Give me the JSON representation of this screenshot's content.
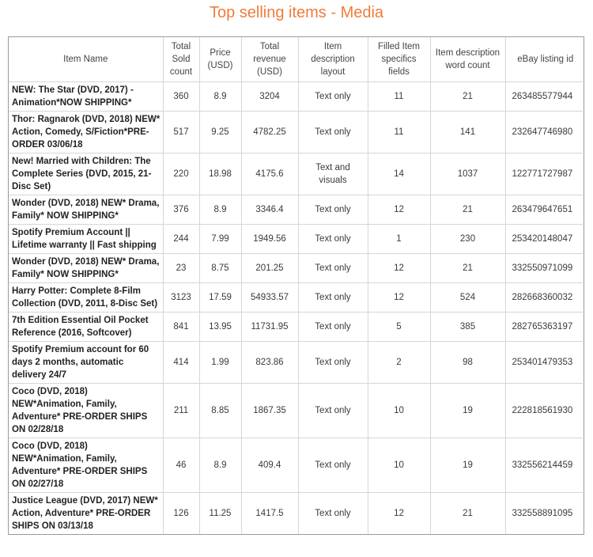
{
  "title": "Top selling items - Media",
  "columns": [
    "Item Name",
    "Total Sold count",
    "Price (USD)",
    "Total revenue (USD)",
    "Item description layout",
    "Filled Item specifics fields",
    "Item description word count",
    "eBay listing id"
  ],
  "rows": [
    {
      "name": "NEW: The Star (DVD, 2017) - Animation*NOW SHIPPING*",
      "sold": "360",
      "price": "8.9",
      "revenue": "3204",
      "layout": "Text only",
      "specifics": "11",
      "words": "21",
      "listing": "263485577944"
    },
    {
      "name": "Thor: Ragnarok (DVD, 2018) NEW* Action, Comedy, S/Fiction*PRE-ORDER 03/06/18",
      "sold": "517",
      "price": "9.25",
      "revenue": "4782.25",
      "layout": "Text only",
      "specifics": "11",
      "words": "141",
      "listing": "232647746980"
    },
    {
      "name": "New! Married with Children: The Complete Series (DVD, 2015, 21-Disc Set)",
      "sold": "220",
      "price": "18.98",
      "revenue": "4175.6",
      "layout": "Text and visuals",
      "specifics": "14",
      "words": "1037",
      "listing": "122771727987"
    },
    {
      "name": "Wonder (DVD, 2018) NEW* Drama, Family* NOW SHIPPING*",
      "sold": "376",
      "price": "8.9",
      "revenue": "3346.4",
      "layout": "Text only",
      "specifics": "12",
      "words": "21",
      "listing": "263479647651"
    },
    {
      "name": "Spotify Premium Account || Lifetime warranty || Fast shipping",
      "sold": "244",
      "price": "7.99",
      "revenue": "1949.56",
      "layout": "Text only",
      "specifics": "1",
      "words": "230",
      "listing": "253420148047"
    },
    {
      "name": "Wonder (DVD, 2018) NEW* Drama, Family* NOW SHIPPING*",
      "sold": "23",
      "price": "8.75",
      "revenue": "201.25",
      "layout": "Text only",
      "specifics": "12",
      "words": "21",
      "listing": "332550971099"
    },
    {
      "name": "Harry Potter: Complete 8-Film Collection (DVD, 2011, 8-Disc Set)",
      "sold": "3123",
      "price": "17.59",
      "revenue": "54933.57",
      "layout": "Text only",
      "specifics": "12",
      "words": "524",
      "listing": "282668360032"
    },
    {
      "name": "7th Edition Essential Oil Pocket Reference (2016, Softcover)",
      "sold": "841",
      "price": "13.95",
      "revenue": "11731.95",
      "layout": "Text only",
      "specifics": "5",
      "words": "385",
      "listing": "282765363197"
    },
    {
      "name": "Spotify Premium account for 60 days 2 months, automatic delivery 24/7",
      "sold": "414",
      "price": "1.99",
      "revenue": "823.86",
      "layout": "Text only",
      "specifics": "2",
      "words": "98",
      "listing": "253401479353"
    },
    {
      "name": "Coco (DVD, 2018) NEW*Animation, Family, Adventure* PRE-ORDER SHIPS ON 02/28/18",
      "sold": "211",
      "price": "8.85",
      "revenue": "1867.35",
      "layout": "Text only",
      "specifics": "10",
      "words": "19",
      "listing": "222818561930"
    },
    {
      "name": "Coco (DVD, 2018) NEW*Animation, Family, Adventure* PRE-ORDER SHIPS ON 02/27/18",
      "sold": "46",
      "price": "8.9",
      "revenue": "409.4",
      "layout": "Text only",
      "specifics": "10",
      "words": "19",
      "listing": "332556214459"
    },
    {
      "name": "Justice League (DVD, 2017) NEW* Action, Adventure* PRE-ORDER SHIPS ON 03/13/18",
      "sold": "126",
      "price": "11.25",
      "revenue": "1417.5",
      "layout": "Text only",
      "specifics": "12",
      "words": "21",
      "listing": "332558891095"
    }
  ]
}
